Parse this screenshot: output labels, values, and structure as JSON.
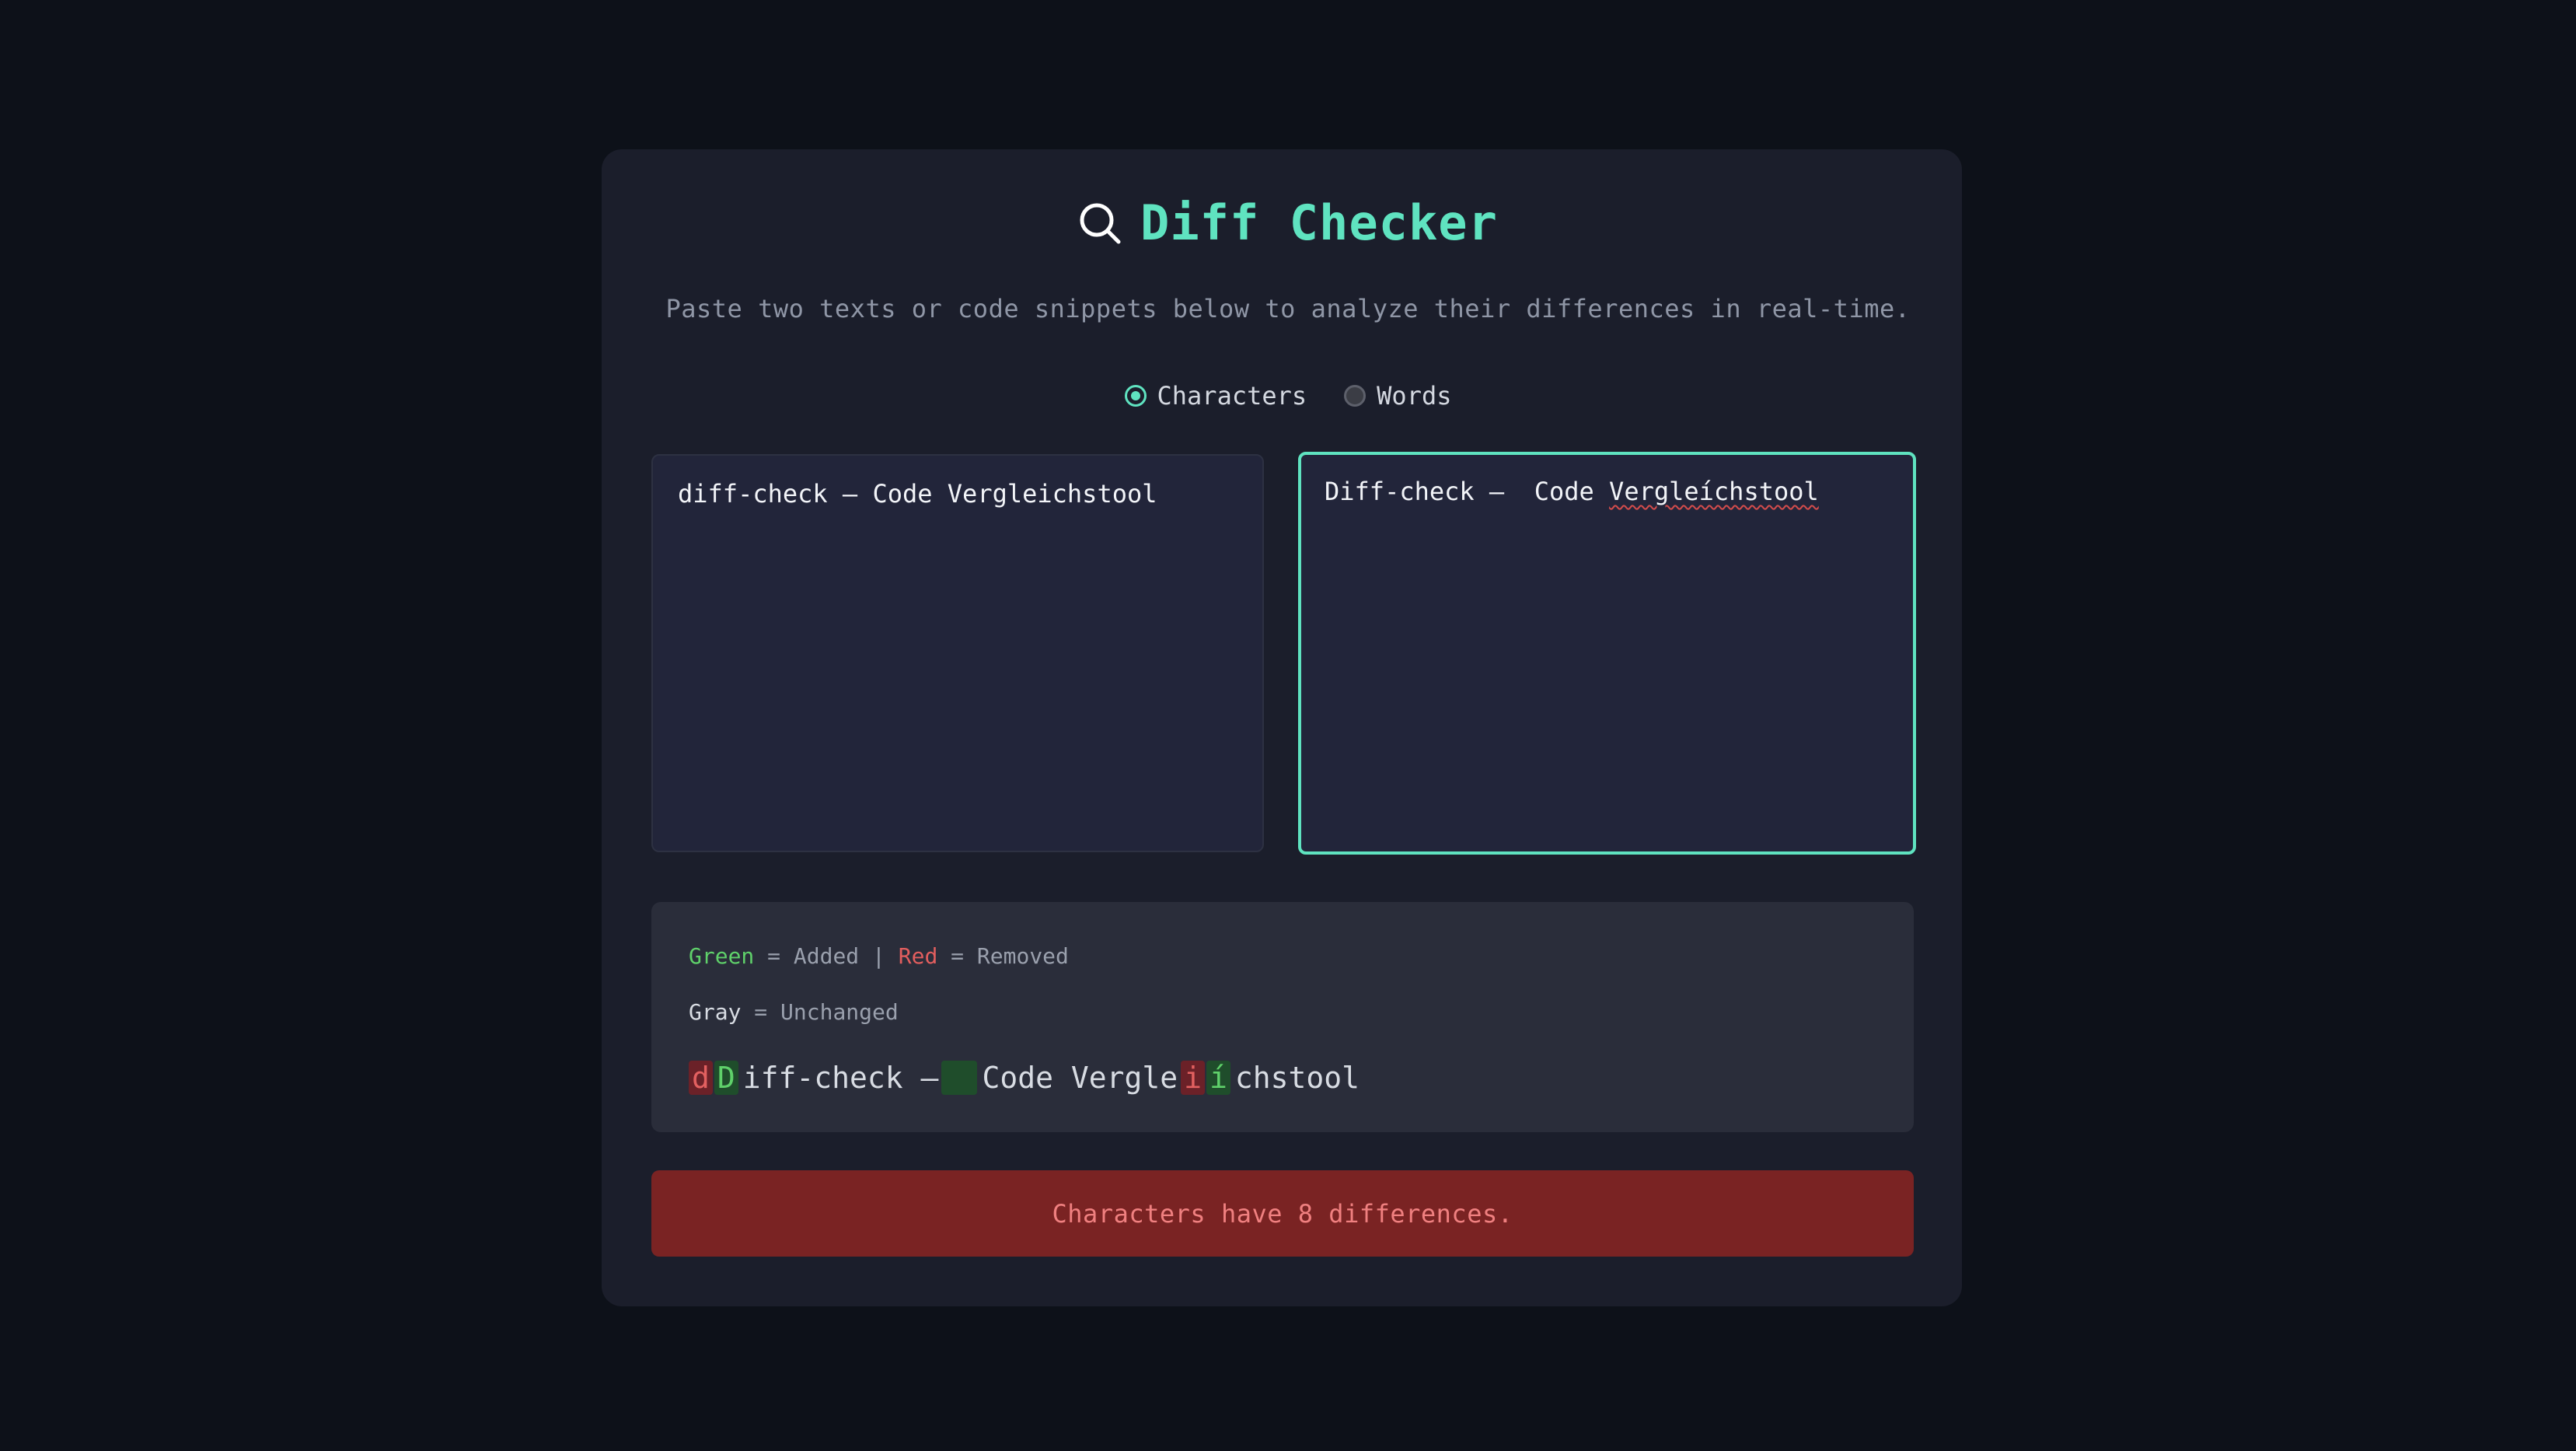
{
  "app": {
    "title": "Diff Checker",
    "subtitle": "Paste two texts or code snippets below to analyze their differences in real-time.",
    "icon": "search-icon",
    "accent_color": "#5fe3c0"
  },
  "modes": {
    "options": [
      {
        "label": "Characters",
        "selected": true
      },
      {
        "label": "Words",
        "selected": false
      }
    ]
  },
  "inputs": {
    "left": {
      "value": "diff-check – Code Vergleichstool",
      "focused": false
    },
    "right": {
      "value_prefix": "Diff-check –  Code ",
      "value_flagged": "Vergleíchstool",
      "focused": true
    }
  },
  "result": {
    "legend": {
      "added_word": "Green",
      "added_text": " = Added | ",
      "removed_word": "Red",
      "removed_text": " = Removed",
      "unchanged_word": "Gray",
      "unchanged_text": " = Unchanged"
    },
    "diff_segments": [
      {
        "type": "removed",
        "text": "d"
      },
      {
        "type": "added",
        "text": "D"
      },
      {
        "type": "same",
        "text": "iff-check –"
      },
      {
        "type": "added",
        "text": " "
      },
      {
        "type": "same",
        "text": "Code Vergle"
      },
      {
        "type": "removed",
        "text": "i"
      },
      {
        "type": "added",
        "text": "í"
      },
      {
        "type": "same",
        "text": "chstool"
      }
    ],
    "colors": {
      "added": "#5fd06a",
      "removed": "#e26060",
      "unchanged": "#d8dce3"
    }
  },
  "status": {
    "message": "Characters have 8 differences.",
    "color": "#7a2323"
  }
}
